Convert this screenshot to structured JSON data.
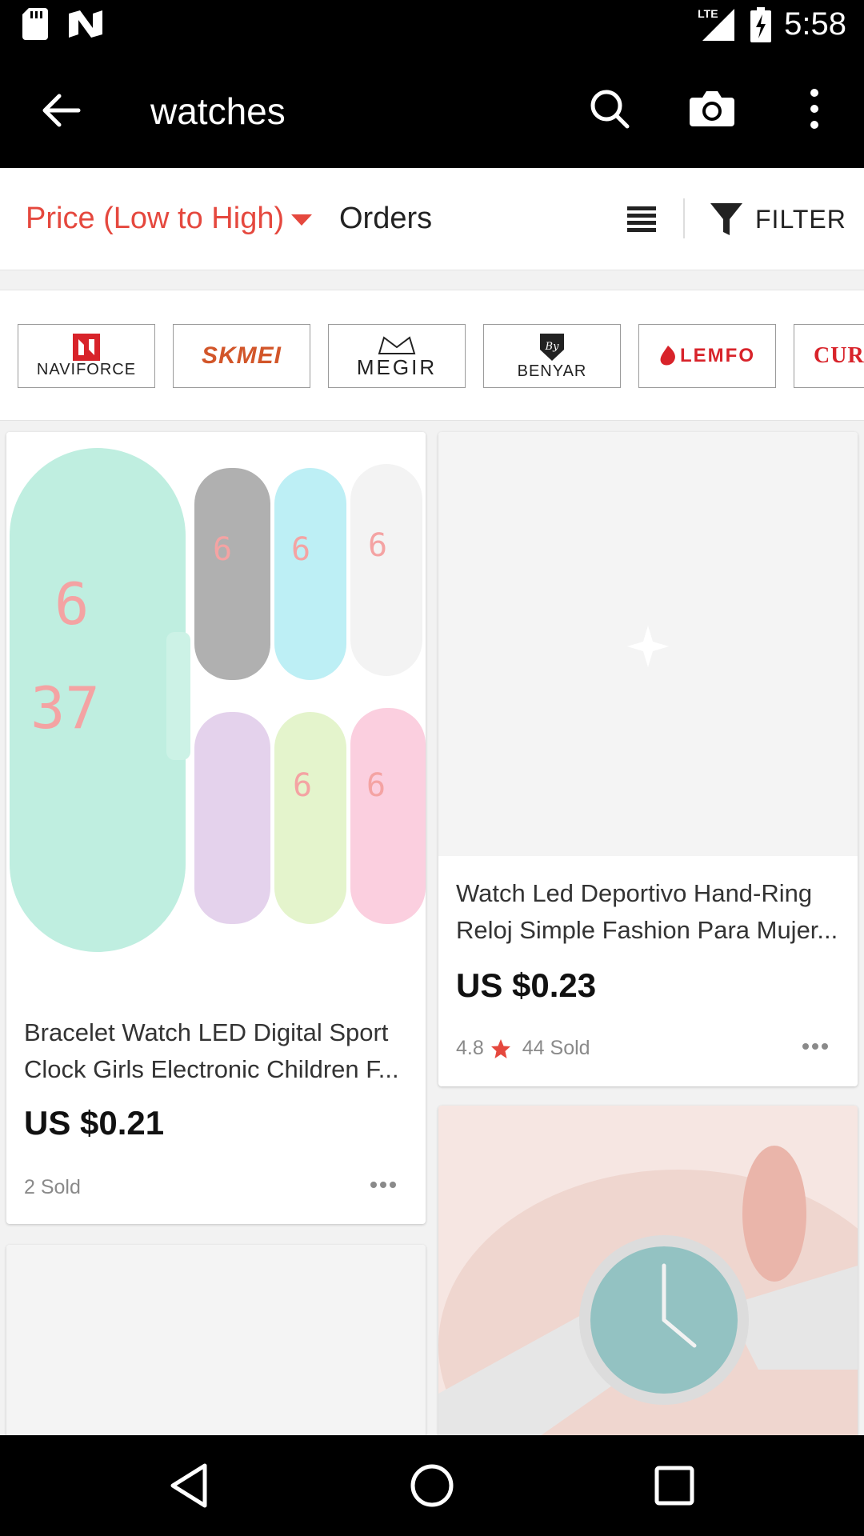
{
  "status_bar": {
    "time": "5:58",
    "network": "LTE",
    "icons": [
      "sd-card-icon",
      "n-notification-icon",
      "signal-icon",
      "battery-charging-icon"
    ]
  },
  "app_bar": {
    "title": "watches",
    "icons": [
      "back-arrow-icon",
      "search-icon",
      "camera-icon",
      "more-vert-icon"
    ]
  },
  "sort_bar": {
    "price_sort_label": "Price (Low to High)",
    "orders_label": "Orders",
    "filter_label": "FILTER",
    "accent_color": "#e5483e"
  },
  "brands": [
    {
      "name": "NAVIFORCE"
    },
    {
      "name": "SKMEI"
    },
    {
      "name": "MEGIR"
    },
    {
      "name": "BENYAR"
    },
    {
      "name": "LEMFO"
    },
    {
      "name": "CUR"
    }
  ],
  "products": [
    {
      "title": "Bracelet Watch LED Digital Sport Clock Girls Electronic Children F...",
      "price": "US $0.21",
      "sold": "2 Sold",
      "rating": ""
    },
    {
      "title": "Watch Led Deportivo Hand-Ring Reloj Simple Fashion Para Mujer...",
      "price": "US $0.23",
      "sold": "44 Sold",
      "rating": "4.8"
    }
  ],
  "nav_bar": {
    "icons": [
      "back-triangle-icon",
      "home-circle-icon",
      "recents-square-icon"
    ]
  }
}
